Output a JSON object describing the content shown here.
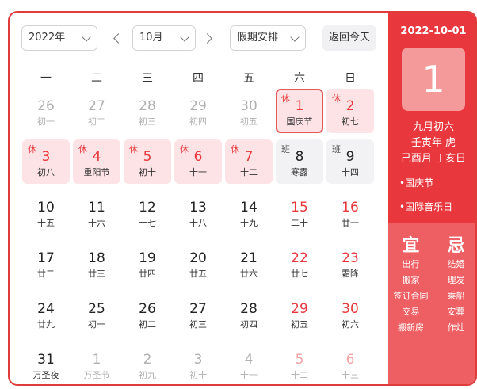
{
  "toolbar": {
    "year": "2022年",
    "month": "10月",
    "holiday": "假期安排",
    "today": "返回今天"
  },
  "weekdays": [
    "一",
    "二",
    "三",
    "四",
    "五",
    "六",
    "日"
  ],
  "days": [
    {
      "day": "26",
      "lunar": "初一",
      "style": "grey"
    },
    {
      "day": "27",
      "lunar": "初二",
      "style": "grey"
    },
    {
      "day": "28",
      "lunar": "初三",
      "style": "grey"
    },
    {
      "day": "29",
      "lunar": "初四",
      "style": "grey"
    },
    {
      "day": "30",
      "lunar": "初五",
      "style": "grey"
    },
    {
      "day": "1",
      "lunar": "国庆节",
      "style": "red",
      "tag": "休",
      "bg": "rest",
      "selected": true
    },
    {
      "day": "2",
      "lunar": "初七",
      "style": "red",
      "tag": "休",
      "bg": "rest"
    },
    {
      "day": "3",
      "lunar": "初八",
      "style": "red",
      "tag": "休",
      "bg": "rest"
    },
    {
      "day": "4",
      "lunar": "重阳节",
      "style": "red",
      "tag": "休",
      "bg": "rest"
    },
    {
      "day": "5",
      "lunar": "初十",
      "style": "red",
      "tag": "休",
      "bg": "rest"
    },
    {
      "day": "6",
      "lunar": "十一",
      "style": "red",
      "tag": "休",
      "bg": "rest"
    },
    {
      "day": "7",
      "lunar": "十二",
      "style": "red",
      "tag": "休",
      "bg": "rest"
    },
    {
      "day": "8",
      "lunar": "寒露",
      "style": "dark",
      "tag": "班",
      "bg": "work"
    },
    {
      "day": "9",
      "lunar": "十四",
      "style": "dark",
      "tag": "班",
      "bg": "work"
    },
    {
      "day": "10",
      "lunar": "十五",
      "style": "dark"
    },
    {
      "day": "11",
      "lunar": "十六",
      "style": "dark"
    },
    {
      "day": "12",
      "lunar": "十七",
      "style": "dark"
    },
    {
      "day": "13",
      "lunar": "十八",
      "style": "dark"
    },
    {
      "day": "14",
      "lunar": "十九",
      "style": "dark"
    },
    {
      "day": "15",
      "lunar": "二十",
      "style": "red"
    },
    {
      "day": "16",
      "lunar": "廿一",
      "style": "red"
    },
    {
      "day": "17",
      "lunar": "廿二",
      "style": "dark"
    },
    {
      "day": "18",
      "lunar": "廿三",
      "style": "dark"
    },
    {
      "day": "19",
      "lunar": "廿四",
      "style": "dark"
    },
    {
      "day": "20",
      "lunar": "廿五",
      "style": "dark"
    },
    {
      "day": "21",
      "lunar": "廿六",
      "style": "dark"
    },
    {
      "day": "22",
      "lunar": "廿七",
      "style": "red"
    },
    {
      "day": "23",
      "lunar": "霜降",
      "style": "red"
    },
    {
      "day": "24",
      "lunar": "廿九",
      "style": "dark"
    },
    {
      "day": "25",
      "lunar": "初一",
      "style": "dark"
    },
    {
      "day": "26",
      "lunar": "初二",
      "style": "dark"
    },
    {
      "day": "27",
      "lunar": "初三",
      "style": "dark"
    },
    {
      "day": "28",
      "lunar": "初四",
      "style": "dark"
    },
    {
      "day": "29",
      "lunar": "初五",
      "style": "red"
    },
    {
      "day": "30",
      "lunar": "初六",
      "style": "red"
    },
    {
      "day": "31",
      "lunar": "万圣夜",
      "style": "dark"
    },
    {
      "day": "1",
      "lunar": "万圣节",
      "style": "grey"
    },
    {
      "day": "2",
      "lunar": "初九",
      "style": "grey"
    },
    {
      "day": "3",
      "lunar": "初十",
      "style": "grey"
    },
    {
      "day": "4",
      "lunar": "十一",
      "style": "grey"
    },
    {
      "day": "5",
      "lunar": "十二",
      "style": "pink"
    },
    {
      "day": "6",
      "lunar": "十三",
      "style": "pink"
    }
  ],
  "panel": {
    "date": "2022-10-01",
    "day": "1",
    "lunar_date": "九月初六",
    "year_ganzhi": "壬寅年 虎",
    "month_day_ganzhi": "己酉月 丁亥日",
    "festivals": [
      "•国庆节",
      "•国际音乐日"
    ],
    "yi_title": "宜",
    "ji_title": "忌",
    "yi": [
      "出行",
      "搬家",
      "签订合同",
      "交易",
      "搬新房"
    ],
    "ji": [
      "结婚",
      "理发",
      "乘船",
      "安葬",
      "作灶"
    ]
  },
  "colors": {
    "accent_red": "#e8383d",
    "rest_bg": "#fde3e5",
    "work_bg": "#f2f2f4",
    "yiji_bg": "#ee5f63"
  }
}
